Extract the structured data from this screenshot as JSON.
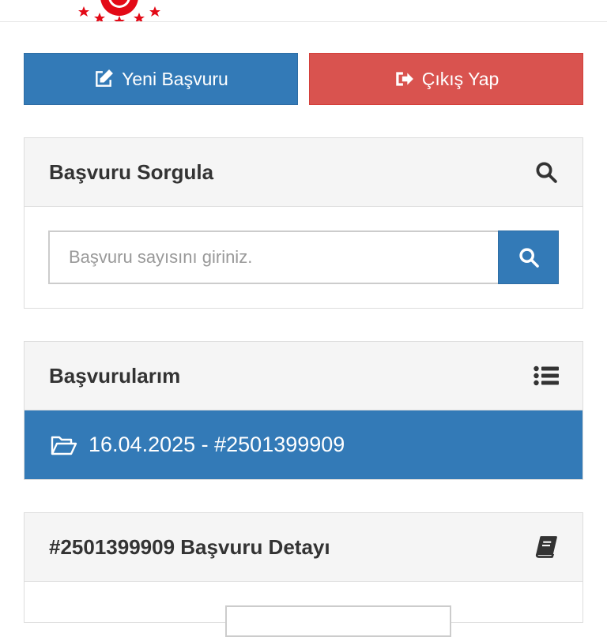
{
  "header": {
    "logo_icon": "emblem-logo"
  },
  "actions": {
    "new_application": {
      "label": "Yeni Başvuru",
      "icon": "edit-icon",
      "color": "#337ab7"
    },
    "logout": {
      "label": "Çıkış Yap",
      "icon": "sign-out-icon",
      "color": "#d9534f"
    }
  },
  "query_panel": {
    "title": "Başvuru Sorgula",
    "icon": "search-icon",
    "input": {
      "placeholder": "Başvuru sayısını giriniz.",
      "value": ""
    },
    "button_icon": "search-icon"
  },
  "applications_panel": {
    "title": "Başvurularım",
    "icon": "list-icon",
    "items": [
      {
        "label": "16.04.2025 - #2501399909",
        "icon": "folder-open-icon"
      }
    ]
  },
  "detail_panel": {
    "title": "#2501399909 Başvuru Detayı",
    "icon": "book-icon"
  },
  "colors": {
    "primary": "#337ab7",
    "danger": "#d9534f",
    "panel_heading": "#f5f5f5"
  }
}
